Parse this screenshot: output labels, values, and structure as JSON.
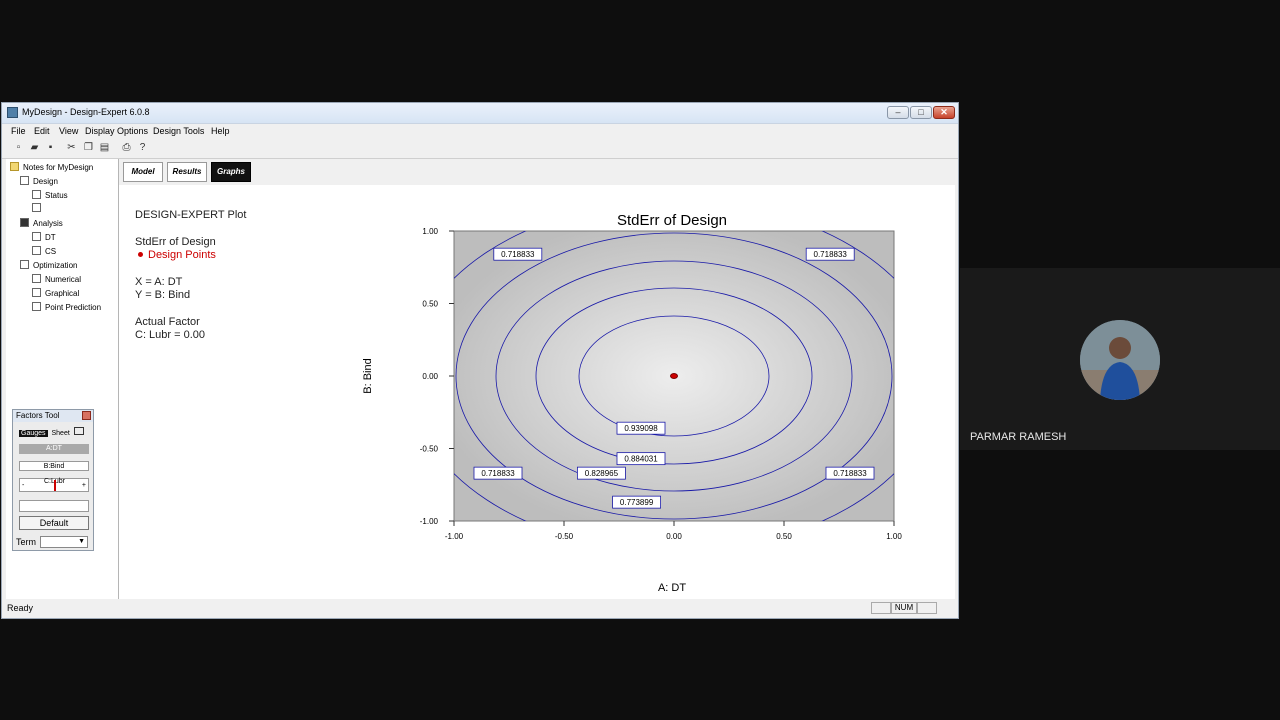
{
  "window": {
    "title": "MyDesign - Design-Expert 6.0.8",
    "min": "–",
    "max": "□",
    "close": "✕"
  },
  "menu": [
    "File",
    "Edit",
    "View",
    "Display Options",
    "Design Tools",
    "Help"
  ],
  "toolbar_icons": [
    "new-file-icon",
    "open-folder-icon",
    "save-icon",
    "cut-icon",
    "copy-icon",
    "paste-icon",
    "print-icon",
    "help-icon"
  ],
  "tree": {
    "root": "Notes for MyDesign",
    "design": "Design",
    "status": "Status",
    "analysis": "Analysis",
    "dt": "DT",
    "cs": "CS",
    "optimization": "Optimization",
    "numerical": "Numerical",
    "graphical": "Graphical",
    "point_prediction": "Point Prediction"
  },
  "factors_tool": {
    "title": "Factors Tool",
    "gauges": "Gauges",
    "sheet": "Sheet",
    "a_label": "A:DT",
    "b_label": "B:Bind",
    "c_label": "C:Lubr",
    "c_min": "-",
    "c_max": "+",
    "default": "Default",
    "term": "Term"
  },
  "tabs": {
    "model": "Model",
    "results": "Results",
    "graphs": "Graphs"
  },
  "legend": {
    "heading": "DESIGN-EXPERT Plot",
    "response": "StdErr of Design",
    "points": "Design Points",
    "x_def": "X = A: DT",
    "y_def": "Y = B: Bind",
    "actual": "Actual Factor",
    "c_value": "C: Lubr = 0.00"
  },
  "chart_data": {
    "type": "contour",
    "title": "StdErr of Design",
    "xlabel": "A: DT",
    "ylabel": "B: Bind",
    "xlim": [
      -1.0,
      1.0
    ],
    "ylim": [
      -1.0,
      1.0
    ],
    "x_ticks": [
      "-1.00",
      "-0.50",
      "0.00",
      "0.50",
      "1.00"
    ],
    "y_ticks": [
      "1.00",
      "0.50",
      "0.00",
      "-0.50",
      "-1.00"
    ],
    "contour_labels": [
      {
        "value": "0.939098",
        "x": -0.15,
        "y": -0.36
      },
      {
        "value": "0.884031",
        "x": -0.15,
        "y": -0.57
      },
      {
        "value": "0.828965",
        "x": -0.33,
        "y": -0.67
      },
      {
        "value": "0.773899",
        "x": -0.17,
        "y": -0.87
      },
      {
        "value": "0.718833",
        "x": -0.71,
        "y": 0.84
      },
      {
        "value": "0.718833",
        "x": 0.71,
        "y": 0.84
      },
      {
        "value": "0.718833",
        "x": -0.8,
        "y": -0.67
      },
      {
        "value": "0.718833",
        "x": 0.8,
        "y": -0.67
      }
    ],
    "design_points": [
      {
        "x": 0.0,
        "y": 0.0
      }
    ],
    "point_color": "#cc0000",
    "contour_color": "#1a1aa8",
    "grid": false
  },
  "status": {
    "text": "Ready",
    "num": "NUM"
  },
  "participant": {
    "name": "PARMAR RAMESH"
  }
}
